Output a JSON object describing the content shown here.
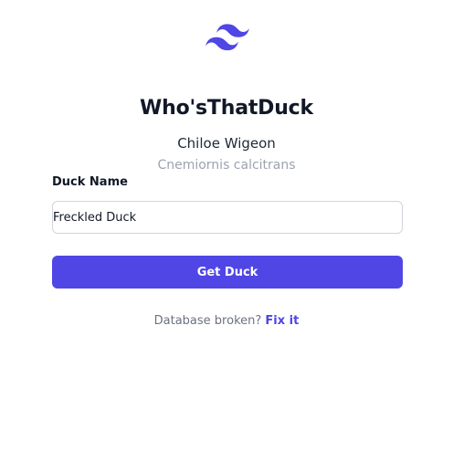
{
  "app": {
    "title": "Who'sThatDuck",
    "logo_icon": "tailwind-wave-logo",
    "accent_color": "#4f46e5"
  },
  "duck": {
    "common_name": "Chiloe Wigeon",
    "latin_name": "Cnemiornis calcitrans"
  },
  "form": {
    "label": "Duck Name",
    "input_value": "Freckled Duck",
    "submit_label": "Get Duck"
  },
  "footer": {
    "text": "Database broken?",
    "link_label": "Fix it"
  }
}
